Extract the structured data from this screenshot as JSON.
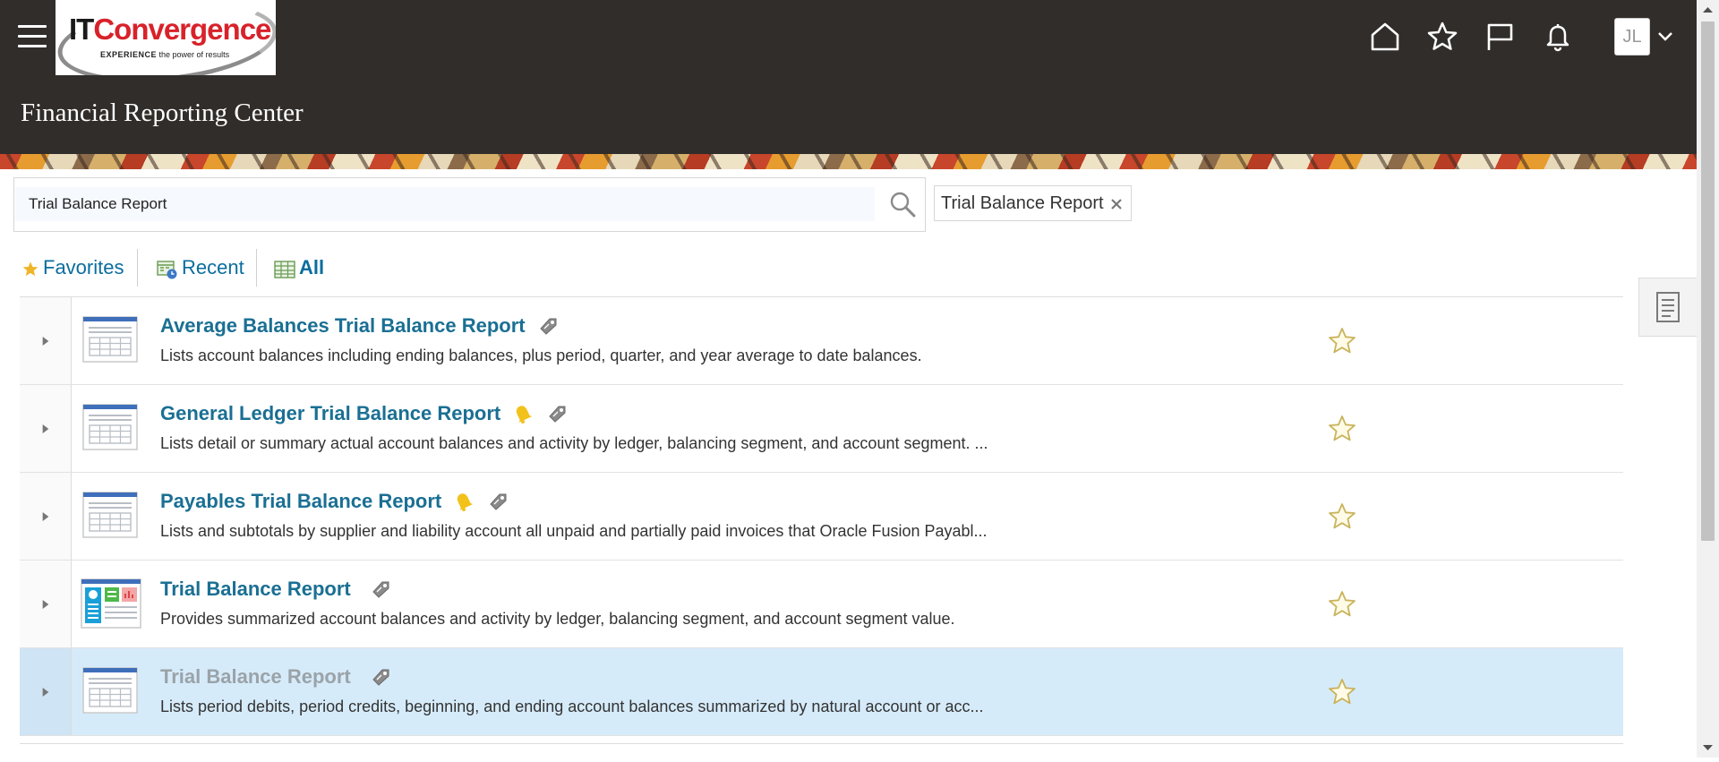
{
  "app": {
    "page_title": "Financial Reporting Center",
    "logo": {
      "brand_dark": "IT",
      "brand_red": "Convergence",
      "tagline_bold": "EXPERIENCE",
      "tagline_rest": " the power of results"
    }
  },
  "header_icons": [
    "home-icon",
    "favorites-star-icon",
    "flag-icon",
    "notifications-bell-icon"
  ],
  "user": {
    "initials": "JL"
  },
  "search": {
    "value": "Trial Balance Report",
    "placeholder": ""
  },
  "filter_chip": {
    "label": "Trial Balance Report"
  },
  "tabs": [
    {
      "label": "Favorites",
      "icon": "star-icon",
      "active": false
    },
    {
      "label": "Recent",
      "icon": "recent-calendar-icon",
      "active": false
    },
    {
      "label": "All",
      "icon": "grid-icon",
      "active": true
    }
  ],
  "reports": [
    {
      "title": "Average Balances Trial Balance Report",
      "description": "Lists account balances including ending balances, plus period, quarter, and year average to date balances.",
      "thumbnail": "table-report",
      "has_bell": false,
      "selected": false
    },
    {
      "title": "General Ledger Trial Balance Report",
      "description": "Lists detail or summary actual account balances and activity by ledger, balancing segment, and account segment. ...",
      "thumbnail": "table-report",
      "has_bell": true,
      "selected": false
    },
    {
      "title": "Payables Trial Balance Report",
      "description": "Lists and subtotals by supplier and liability account all unpaid and partially paid invoices that Oracle Fusion Payabl...",
      "thumbnail": "table-report",
      "has_bell": true,
      "selected": false
    },
    {
      "title": "Trial Balance Report",
      "description": "Provides summarized account balances and activity by ledger, balancing segment, and account segment value.",
      "thumbnail": "dashboard-report",
      "has_bell": false,
      "selected": false
    },
    {
      "title": "Trial Balance Report",
      "description": "Lists period debits, period credits, beginning, and ending account balances summarized by natural account or acc...",
      "thumbnail": "table-report",
      "has_bell": false,
      "selected": true
    }
  ],
  "colors": {
    "header_bg": "#312d2a",
    "link_blue": "#1a6f93",
    "selected_row": "#d6ebfa",
    "star_outline": "#c9b35a"
  }
}
